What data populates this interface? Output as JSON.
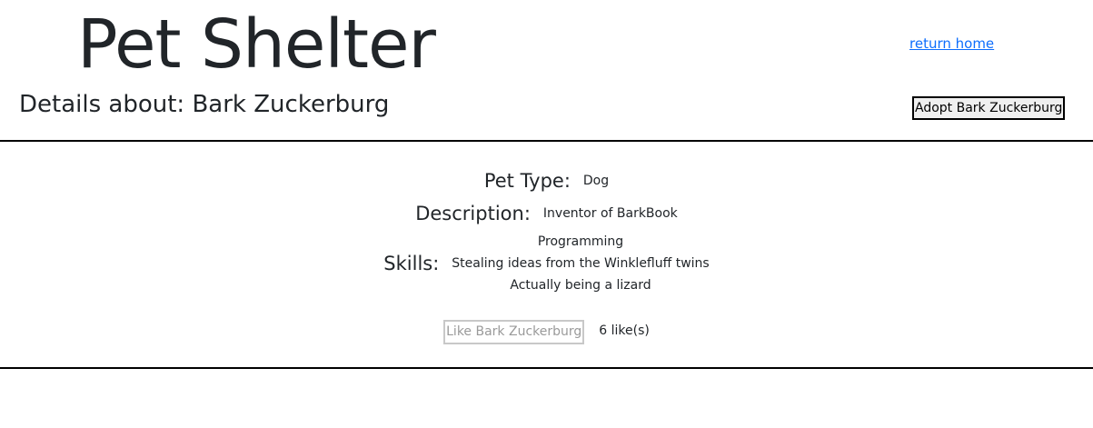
{
  "header": {
    "site_title": "Pet Shelter",
    "home_link": "return home"
  },
  "details": {
    "heading_prefix": "Details about: ",
    "pet_name": "Bark Zuckerburg",
    "adopt_button": "Adopt Bark Zuckerburg"
  },
  "pet": {
    "type_label": "Pet Type:",
    "type_value": "Dog",
    "description_label": "Description:",
    "description_value": "Inventor of BarkBook",
    "skills_label": "Skills:",
    "skills": [
      "Programming",
      "Stealing ideas from the Winklefluff twins",
      "Actually being a lizard"
    ]
  },
  "likes": {
    "like_button": "Like Bark Zuckerburg",
    "like_count": "6 like(s)"
  },
  "colors": {
    "link": "#0d6efd",
    "text": "#212529",
    "disabled_text": "#9a9a9a"
  }
}
